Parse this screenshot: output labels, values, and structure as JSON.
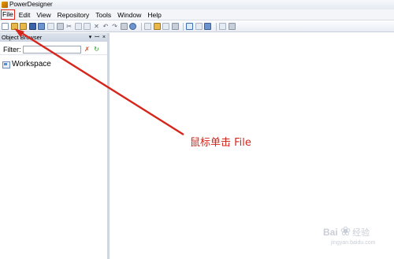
{
  "window": {
    "title": "PowerDesigner"
  },
  "menu": {
    "items": [
      {
        "key": "file",
        "label": "File"
      },
      {
        "key": "edit",
        "label": "Edit"
      },
      {
        "key": "view",
        "label": "View"
      },
      {
        "key": "repository",
        "label": "Repository"
      },
      {
        "key": "tools",
        "label": "Tools"
      },
      {
        "key": "window",
        "label": "Window"
      },
      {
        "key": "help",
        "label": "Help"
      }
    ],
    "highlighted": "file",
    "highlight_color": "#e0261c"
  },
  "toolbar": {
    "icons": [
      "new-icon",
      "open-folder-icon",
      "open-icon",
      "save-icon",
      "save-all-icon",
      "print-preview-icon",
      "print-icon",
      "cut-icon",
      "copy-icon",
      "paste-icon",
      "delete-icon",
      "undo-icon",
      "redo-icon",
      "find-icon",
      "check-model-icon",
      "diagram-icon",
      "model-icon",
      "report-icon",
      "repository-icon",
      "browser-toggle-icon",
      "output-icon",
      "result-list-icon",
      "generate-icon",
      "reverse-icon"
    ]
  },
  "object_browser": {
    "title": "Object Browser",
    "pin_glyph": "▾",
    "close_glyph": "×",
    "filter_label": "Filter:",
    "filter_value": "",
    "root_label": "Workspace"
  },
  "annotation": {
    "text": "鼠标单击 File",
    "color": "#d6261c"
  },
  "watermark": {
    "text": "Bai",
    "text2": "经验",
    "sub": "jingyan.baidu.com"
  }
}
